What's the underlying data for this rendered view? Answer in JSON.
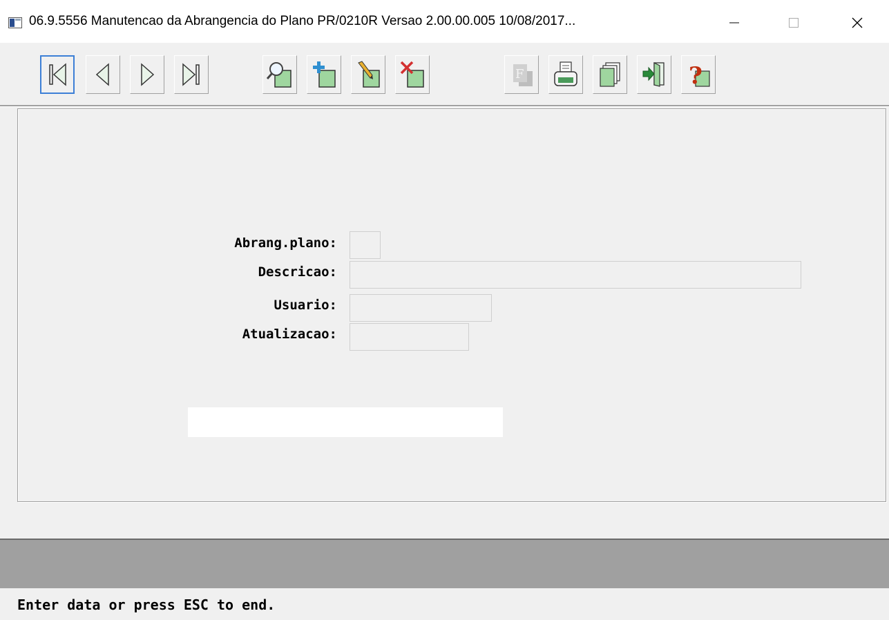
{
  "window": {
    "title": "06.9.5556 Manutencao  da Abrangencia do Plano PR/0210R Versao 2.00.00.005 10/08/2017...",
    "app_icon": "app-window-icon",
    "minimize_icon": "minimize-icon",
    "maximize_icon": "maximize-icon",
    "close_icon": "close-icon"
  },
  "toolbar": {
    "buttons": [
      {
        "icon": "first-record-icon"
      },
      {
        "icon": "previous-record-icon"
      },
      {
        "icon": "next-record-icon"
      },
      {
        "icon": "last-record-icon"
      },
      {
        "icon": "search-icon"
      },
      {
        "icon": "add-record-icon"
      },
      {
        "icon": "edit-record-icon"
      },
      {
        "icon": "delete-record-icon"
      },
      {
        "icon": "filter-icon",
        "disabled": true
      },
      {
        "icon": "print-icon"
      },
      {
        "icon": "copy-icon"
      },
      {
        "icon": "exit-icon"
      },
      {
        "icon": "help-icon"
      }
    ]
  },
  "form": {
    "abrang_plano_label": "Abrang.plano:",
    "abrang_plano_value": "",
    "descricao_label": "Descricao:",
    "descricao_value": "",
    "usuario_label": "Usuario:",
    "usuario_value": "",
    "atualizacao_label": "Atualizacao:",
    "atualizacao_value": ""
  },
  "status": {
    "message": "Enter data or press ESC to end."
  },
  "colors": {
    "background": "#f0f0f0",
    "accent": "#3c7fd6",
    "icon_green": "#78b878",
    "delete_red": "#d33030",
    "help_red": "#c03010",
    "graybar": "#a0a0a0"
  }
}
